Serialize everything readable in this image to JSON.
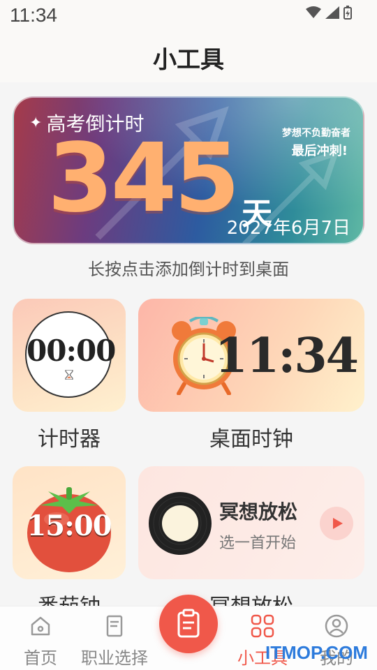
{
  "status_bar": {
    "time": "11:34"
  },
  "header": {
    "title": "小工具"
  },
  "banner": {
    "title": "高考倒计时",
    "days": "345",
    "unit": "天",
    "date": "2027年6月7日",
    "slogan_line1": "梦想不负勤奋者",
    "slogan_line2": "最后冲刺!",
    "hint": "长按点击添加倒计时到桌面"
  },
  "tools": {
    "timer": {
      "display": "00:00",
      "label": "计时器"
    },
    "clock": {
      "display": "11:34",
      "label": "桌面时钟"
    },
    "tomato": {
      "display": "15:00",
      "label": "番茄钟"
    },
    "meditation": {
      "title": "冥想放松",
      "subtitle": "选一首开始",
      "label": "冥想放松"
    }
  },
  "nav": {
    "items": [
      {
        "label": "首页",
        "icon": "home-icon"
      },
      {
        "label": "职业选择",
        "icon": "document-icon"
      },
      {
        "label": "小工具",
        "icon": "grid-icon",
        "active": true
      },
      {
        "label": "我的",
        "icon": "user-icon"
      }
    ]
  },
  "watermark": "ITMOP.COM",
  "colors": {
    "accent": "#f0584a",
    "countdown": "#ffb070"
  }
}
